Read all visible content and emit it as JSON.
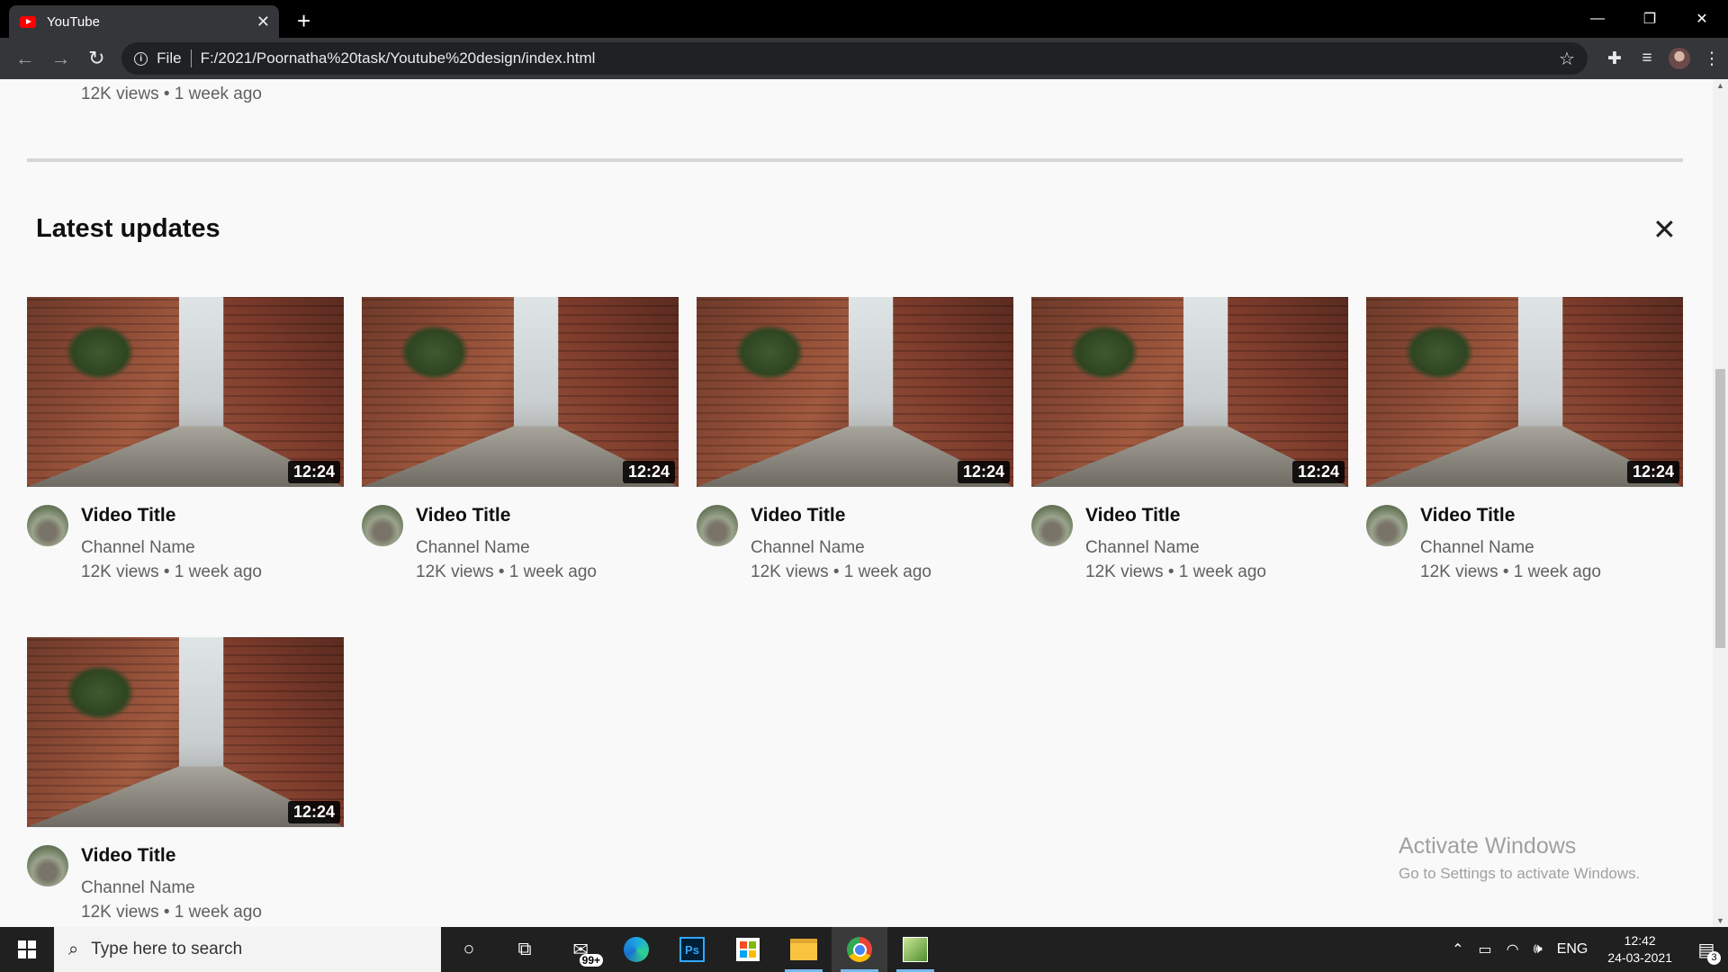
{
  "browser": {
    "tab_title": "YouTube",
    "tab_close": "✕",
    "new_tab": "+",
    "window_controls": [
      "—",
      "❐",
      "✕"
    ],
    "address_label": "File",
    "url": "F:/2021/Poornatha%20task/Youtube%20design/index.html"
  },
  "page": {
    "top_meta": "12K views • 1 week ago",
    "section_title": "Latest updates",
    "section_close": "✕",
    "videos": [
      {
        "duration": "12:24",
        "title": "Video Title",
        "channel": "Channel Name",
        "stats": "12K views • 1 week ago"
      },
      {
        "duration": "12:24",
        "title": "Video Title",
        "channel": "Channel Name",
        "stats": "12K views • 1 week ago"
      },
      {
        "duration": "12:24",
        "title": "Video Title",
        "channel": "Channel Name",
        "stats": "12K views • 1 week ago"
      },
      {
        "duration": "12:24",
        "title": "Video Title",
        "channel": "Channel Name",
        "stats": "12K views • 1 week ago"
      },
      {
        "duration": "12:24",
        "title": "Video Title",
        "channel": "Channel Name",
        "stats": "12K views • 1 week ago"
      },
      {
        "duration": "12:24",
        "title": "Video Title",
        "channel": "Channel Name",
        "stats": "12K views • 1 week ago"
      }
    ],
    "watermark": {
      "line1": "Activate Windows",
      "line2": "Go to Settings to activate Windows."
    }
  },
  "taskbar": {
    "search_placeholder": "Type here to search",
    "mail_badge": "99+",
    "ps_label": "Ps",
    "language": "ENG",
    "time": "12:42",
    "date": "24-03-2021",
    "notification_count": "3"
  },
  "colors": {
    "tab_active": "#35363a",
    "page_bg": "#f9f9f9",
    "youtube_red": "#ff0000",
    "taskbar_bg": "#202020"
  }
}
